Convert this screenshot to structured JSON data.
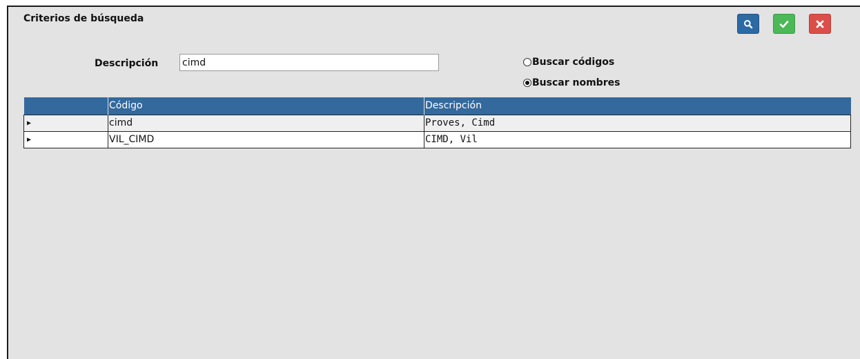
{
  "panel": {
    "title": "Criterios de búsqueda"
  },
  "toolbar": {
    "search_icon": "search-icon",
    "accept_icon": "check-icon",
    "cancel_icon": "close-icon",
    "colors": {
      "search": "#2c6aa3",
      "accept": "#4cb857",
      "cancel": "#da4f49"
    }
  },
  "form": {
    "description_label": "Descripción",
    "description_value": "cimd",
    "search_codes_label": "Buscar códigos",
    "search_names_label": "Buscar nombres",
    "selected_mode": "names"
  },
  "grid": {
    "headers": [
      "",
      "Código",
      "Descripción"
    ],
    "header_color": "#33699d",
    "row_indicator": "▶",
    "rows": [
      {
        "code": "cimd",
        "description": "Proves, Cimd"
      },
      {
        "code": "VIL_CIMD",
        "description": "CIMD, Vil"
      }
    ]
  }
}
